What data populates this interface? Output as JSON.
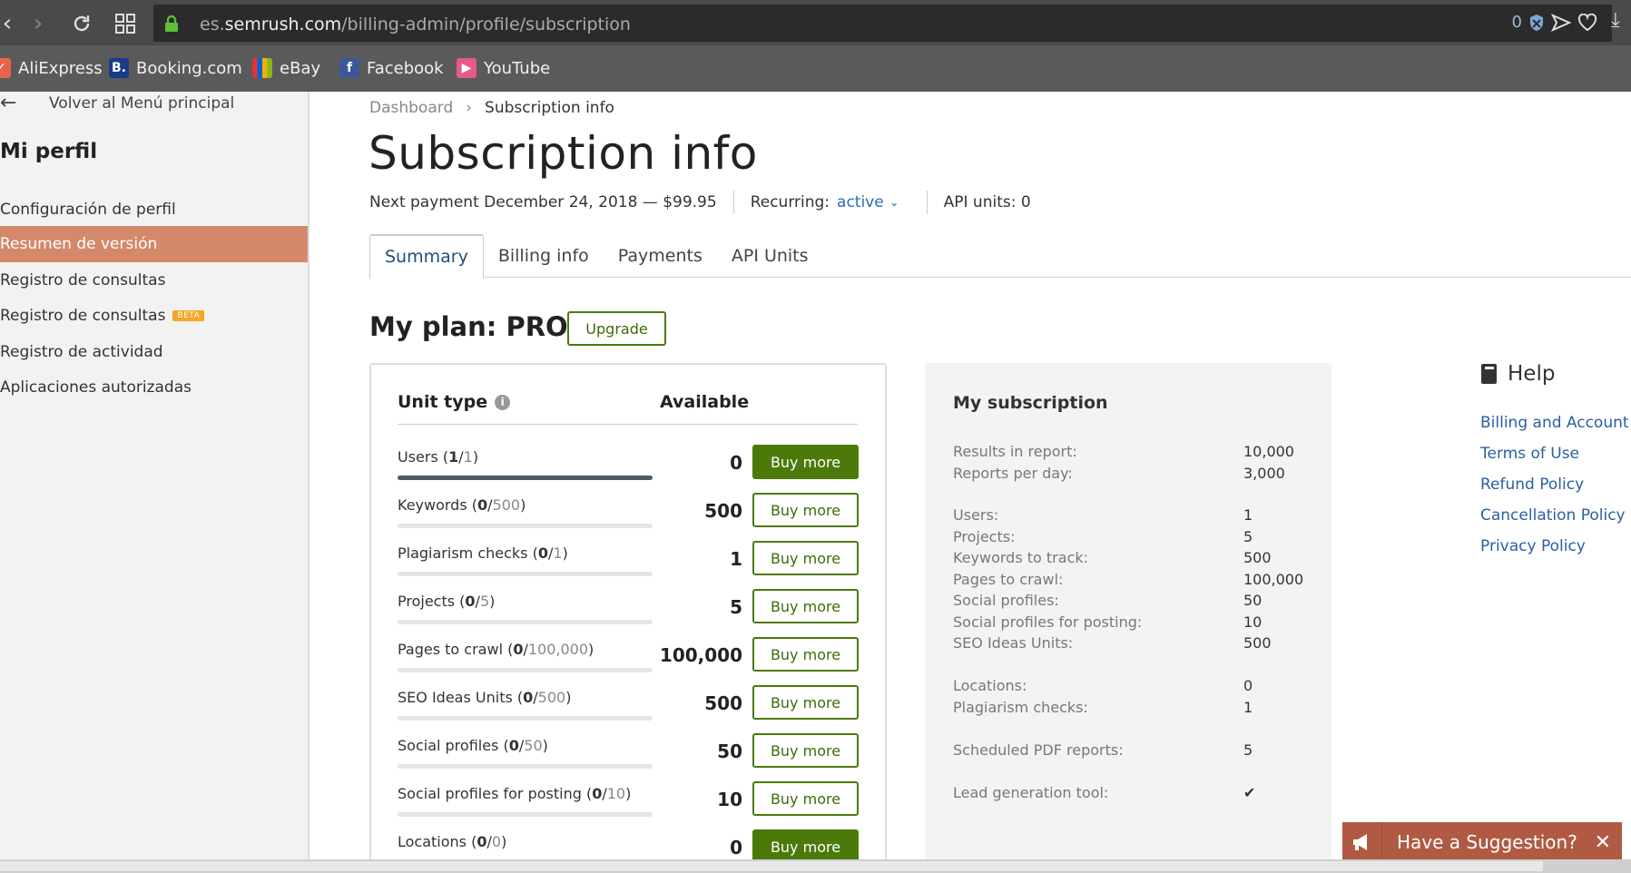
{
  "browser": {
    "url_prefix": "es.",
    "url_domain": "semrush.com",
    "url_path": "/billing-admin/profile/subscription",
    "addr_count": "0",
    "bookmarks": [
      {
        "label": "AliExpress",
        "icon": "aliexpress-icon",
        "color": "#e8634a"
      },
      {
        "label": "Booking.com",
        "icon": "booking-icon",
        "color": "#1a3a8a"
      },
      {
        "label": "eBay",
        "icon": "ebay-icon",
        "color": "#333333"
      },
      {
        "label": "Facebook",
        "icon": "facebook-icon",
        "color": "#3b5998"
      },
      {
        "label": "YouTube",
        "icon": "youtube-icon",
        "color": "#e45a8a"
      }
    ]
  },
  "sidebar": {
    "back_label": "Volver al Menú principal",
    "title": "Mi perfil",
    "items": [
      {
        "label": "Configuración de perfil"
      },
      {
        "label": "Resumen de versión"
      },
      {
        "label": "Registro de consultas"
      },
      {
        "label": "Registro de consultas",
        "badge": "BETA"
      },
      {
        "label": "Registro de actividad"
      },
      {
        "label": "Aplicaciones autorizadas"
      }
    ]
  },
  "breadcrumb": {
    "root": "Dashboard",
    "current": "Subscription info"
  },
  "page_title": "Subscription info",
  "meta": {
    "next_payment": "Next payment December 24, 2018 — $99.95",
    "recurring_label": "Recurring:",
    "recurring_value": "active",
    "api_units": "API units: 0"
  },
  "tabs": [
    "Summary",
    "Billing info",
    "Payments",
    "API Units"
  ],
  "plan": {
    "title": "My plan: PRO",
    "upgrade_label": "Upgrade"
  },
  "units": {
    "header_type": "Unit type",
    "header_available": "Available",
    "buy_label": "Buy more",
    "rows": [
      {
        "name": "Users",
        "used": "1",
        "limit": "1",
        "available": "0",
        "fill": 1.0
      },
      {
        "name": "Keywords",
        "used": "0",
        "limit": "500",
        "available": "500",
        "fill": 0
      },
      {
        "name": "Plagiarism checks",
        "used": "0",
        "limit": "1",
        "available": "1",
        "fill": 0
      },
      {
        "name": "Projects",
        "used": "0",
        "limit": "5",
        "available": "5",
        "fill": 0
      },
      {
        "name": "Pages to crawl",
        "used": "0",
        "limit": "100,000",
        "available": "100,000",
        "fill": 0
      },
      {
        "name": "SEO Ideas Units",
        "used": "0",
        "limit": "500",
        "available": "500",
        "fill": 0
      },
      {
        "name": "Social profiles",
        "used": "0",
        "limit": "50",
        "available": "50",
        "fill": 0
      },
      {
        "name": "Social profiles for posting",
        "used": "0",
        "limit": "10",
        "available": "10",
        "fill": 0
      },
      {
        "name": "Locations",
        "used": "0",
        "limit": "0",
        "available": "0",
        "fill": 0
      }
    ]
  },
  "subscription": {
    "title": "My subscription",
    "rows": [
      {
        "k": "Results in report:",
        "v": "10,000"
      },
      {
        "k": "Reports per day:",
        "v": "3,000"
      },
      {
        "k": "Users:",
        "v": "1"
      },
      {
        "k": "Projects:",
        "v": "5"
      },
      {
        "k": "Keywords to track:",
        "v": "500"
      },
      {
        "k": "Pages to crawl:",
        "v": "100,000"
      },
      {
        "k": "Social profiles:",
        "v": "50"
      },
      {
        "k": "Social profiles for posting:",
        "v": "10"
      },
      {
        "k": "SEO Ideas Units:",
        "v": "500"
      },
      {
        "k": "Locations:",
        "v": "0"
      },
      {
        "k": "Plagiarism checks:",
        "v": "1"
      },
      {
        "k": "Scheduled PDF reports:",
        "v": "5"
      },
      {
        "k": "Lead generation tool:",
        "v": "✔"
      }
    ]
  },
  "help": {
    "title": "Help",
    "links": [
      "Billing and Account",
      "Terms of Use",
      "Refund Policy",
      "Cancellation Policy",
      "Privacy Policy"
    ]
  },
  "suggestion": {
    "label": "Have a Suggestion?",
    "close": "✕"
  }
}
